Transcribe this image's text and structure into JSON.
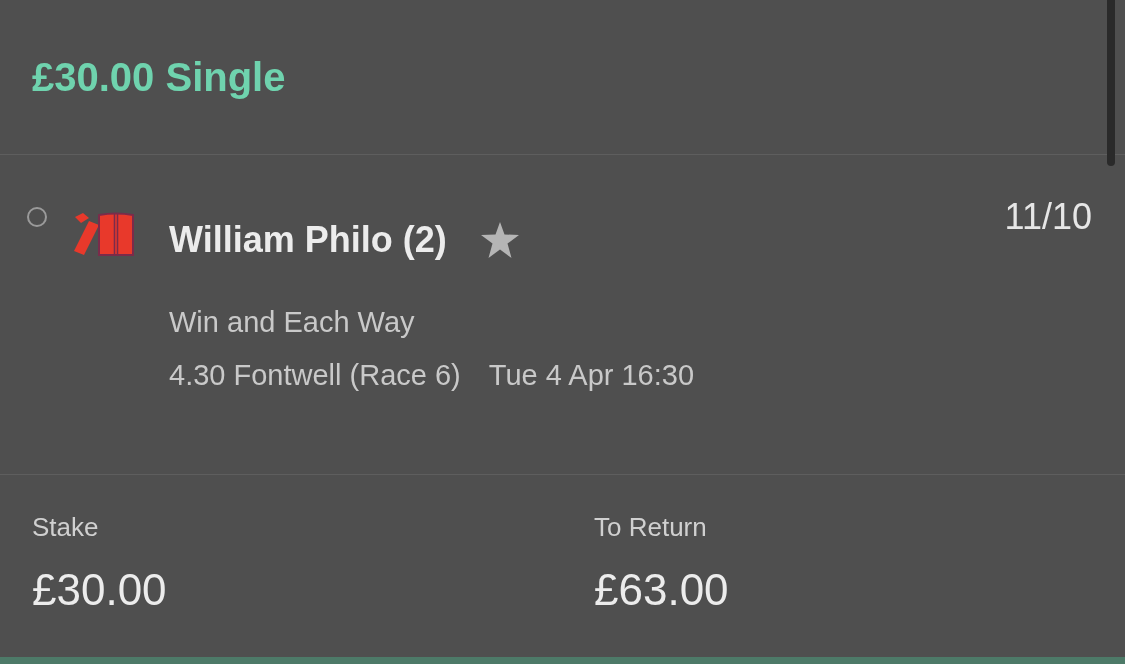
{
  "header": {
    "title": "£30.00 Single"
  },
  "selection": {
    "selected": false,
    "name": "William Philo (2)",
    "odds": "11/10",
    "market": "Win and Each Way",
    "event": "4.30 Fontwell (Race 6)",
    "start_time": "Tue 4 Apr 16:30"
  },
  "totals": [
    {
      "label": "Stake",
      "value": "£30.00"
    },
    {
      "label": "To Return",
      "value": "£63.00"
    }
  ]
}
